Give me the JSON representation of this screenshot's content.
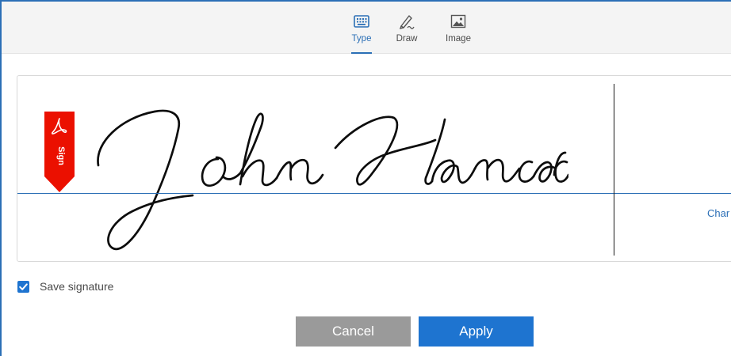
{
  "tabs": [
    {
      "label": "Type",
      "icon": "keyboard-icon",
      "active": true
    },
    {
      "label": "Draw",
      "icon": "pen-draw-icon",
      "active": false
    },
    {
      "label": "Image",
      "icon": "image-icon",
      "active": false
    }
  ],
  "signature": {
    "typed_text": "John Hancock",
    "change_link": "Char",
    "badge_label": "Sign"
  },
  "save": {
    "label": "Save signature",
    "checked": true
  },
  "buttons": {
    "cancel": "Cancel",
    "apply": "Apply"
  },
  "colors": {
    "accent": "#1e74d0",
    "tab_active": "#2b6fb6",
    "badge": "#eb1000",
    "cancel_bg": "#9a9a9a"
  }
}
